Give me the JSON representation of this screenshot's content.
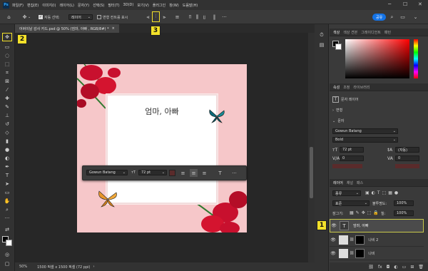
{
  "menubar": {
    "app_icon": "Ps",
    "items": [
      "파일(F)",
      "편집(E)",
      "이미지(I)",
      "레이어(L)",
      "문자(Y)",
      "선택(S)",
      "필터(T)",
      "3D(D)",
      "보기(V)",
      "플러그인",
      "창(W)",
      "도움말(H)"
    ],
    "icons": {
      "minimize": "minimize-icon",
      "maximize": "maximize-icon",
      "close": "close-icon"
    }
  },
  "options_bar": {
    "auto_select_label": "자동 선택:",
    "auto_select_value": "레이어",
    "transform_controls_label": "변형 컨트롤 표시",
    "share_button": "공유"
  },
  "document_tab": {
    "label": "어버이날 감사 카드.psd @ 50% (엄마, 아빠 , RGB/8#) *",
    "close": "×"
  },
  "document": {
    "title_text": "엄마, 아빠",
    "bg_color": "#f6c7c9"
  },
  "context_bar": {
    "font": "Gowun Batang",
    "size": "72 pt",
    "more": "···"
  },
  "status_bar": {
    "zoom": "50%",
    "doc_info": "1500 픽셀 x 1500 픽셀 (72 ppi)"
  },
  "color_panel": {
    "tabs": [
      "색상",
      "색상 견본",
      "그레이디언트",
      "패턴"
    ]
  },
  "properties_panel": {
    "tabs": [
      "속성",
      "조정",
      "라이브러리"
    ],
    "layer_type": "문자 레이어",
    "transform_label": "변형",
    "character_label": "문자",
    "font": "Gowun Batang",
    "style": "Bold",
    "size": "72 pt",
    "leading": "(자동)",
    "kerning": "0",
    "tracking": "0"
  },
  "layers_panel": {
    "tabs": [
      "레이어",
      "채널",
      "패스"
    ],
    "filter_label": "종류",
    "blend_mode": "표준",
    "opacity_label": "불투명도:",
    "opacity_value": "100%",
    "lock_label": "잠그기:",
    "fill_label": "칠:",
    "fill_value": "100%",
    "layers": [
      {
        "name": "엄마, 아빠",
        "type": "text",
        "selected": true
      },
      {
        "name": "나비 2",
        "type": "image",
        "selected": false
      },
      {
        "name": "나비",
        "type": "image",
        "selected": false
      }
    ],
    "footer": "fx"
  },
  "callouts": [
    "1",
    "2",
    "3"
  ],
  "colors": {
    "accent": "#1473e6",
    "callout": "#f3e12a",
    "selection_border": "#c8c84a"
  }
}
